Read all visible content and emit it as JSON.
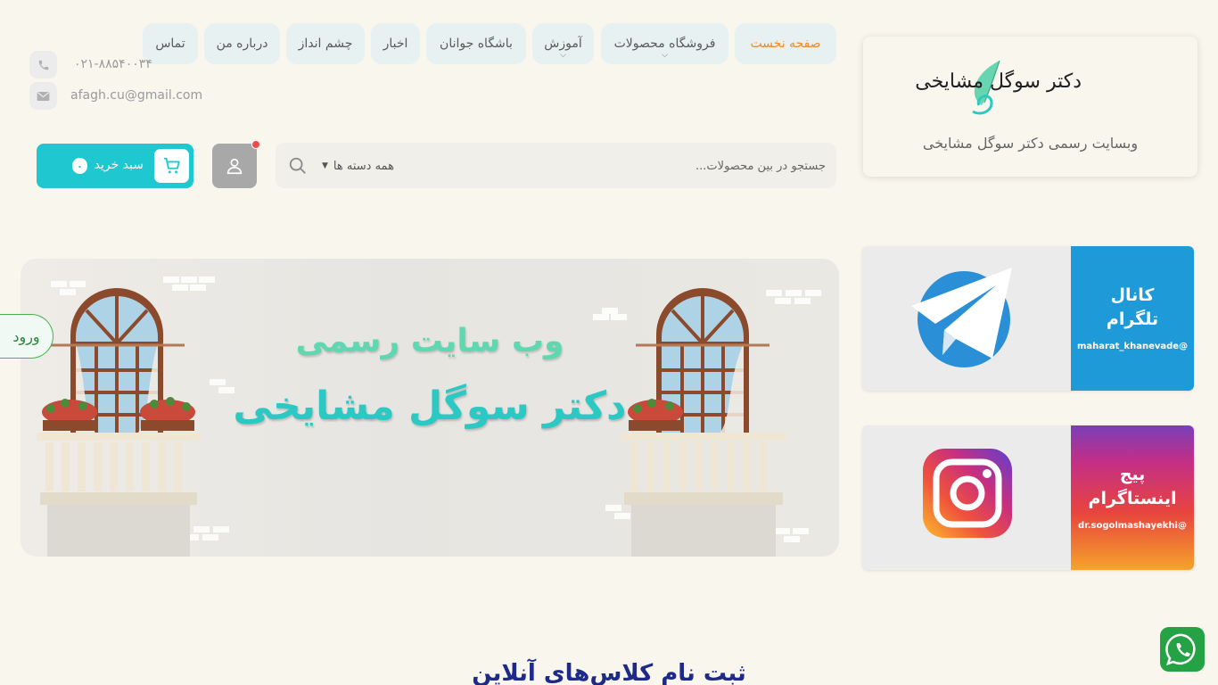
{
  "site": {
    "logo_text": "دکتر سوگل مشایخی",
    "subtitle": "وبسایت رسمی دکتر سوگل مشایخی"
  },
  "nav": {
    "items": [
      {
        "label": "صفحه نخست",
        "active": true,
        "dropdown": false
      },
      {
        "label": "فروشگاه محصولات",
        "active": false,
        "dropdown": true
      },
      {
        "label": "آموزش",
        "active": false,
        "dropdown": true
      },
      {
        "label": "باشگاه جوانان",
        "active": false,
        "dropdown": false
      },
      {
        "label": "اخبار",
        "active": false,
        "dropdown": false
      },
      {
        "label": "چشم انداز",
        "active": false,
        "dropdown": false
      },
      {
        "label": "درباره من",
        "active": false,
        "dropdown": false
      },
      {
        "label": "تماس",
        "active": false,
        "dropdown": false
      }
    ]
  },
  "contact": {
    "phone": "۰۲۱-۸۸۵۴۰۰۳۴",
    "email": "afagh.cu@gmail.com",
    "phone_icon": "phone-icon",
    "email_icon": "envelope-icon"
  },
  "search": {
    "placeholder": "جستجو در بین محصولات...",
    "category": "همه دسته ها",
    "icon": "search-icon"
  },
  "account": {
    "icon": "user-icon",
    "has_notification": true
  },
  "cart": {
    "label": "سبد خرید",
    "count": "۰",
    "icon": "cart-icon"
  },
  "hero": {
    "title1": "وب سایت رسمی",
    "title2": "دکتر سوگل مشایخی"
  },
  "login": {
    "label": "ورود"
  },
  "social": {
    "telegram": {
      "title_line1": "کانال",
      "title_line2": "تلگرام",
      "handle": "@maharat_khanevade",
      "color": "#1e9ad8",
      "icon": "telegram-icon"
    },
    "instagram": {
      "title_line1": "پیج",
      "title_line2": "اینستاگرام",
      "handle": "@dr.sogolmashayekhi",
      "icon": "instagram-icon"
    }
  },
  "section": {
    "heading": "ثبت نام کلاس‌های آنلاین"
  },
  "colors": {
    "accent": "#1fc8d1",
    "active_nav": "#f08a24",
    "background": "#f9f6ee",
    "heading": "#1e2a8a",
    "whatsapp": "#25a244"
  },
  "whatsapp": {
    "icon": "whatsapp-icon"
  }
}
